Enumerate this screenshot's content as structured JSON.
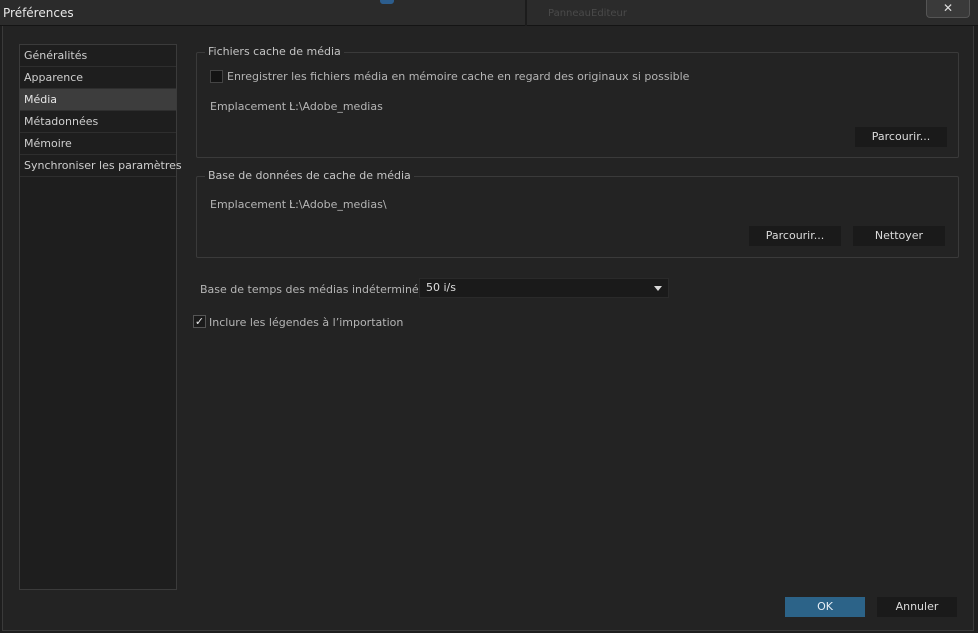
{
  "window": {
    "title": "Préférences",
    "close_glyph": "✕",
    "background_app_label": "PanneauEditeur"
  },
  "sidebar": {
    "items": [
      {
        "label": "Généralités",
        "active": false
      },
      {
        "label": "Apparence",
        "active": false
      },
      {
        "label": "Média",
        "active": true
      },
      {
        "label": "Métadonnées",
        "active": false
      },
      {
        "label": "Mémoire",
        "active": false
      },
      {
        "label": "Synchroniser les paramètres",
        "active": false
      }
    ]
  },
  "media_cache_files": {
    "legend": "Fichiers cache de média",
    "checkbox_label": "Enregistrer les fichiers média en mémoire cache en regard des originaux si possible",
    "checkbox_checked": false,
    "location_label": "Emplacement :",
    "location_value": "L:\\Adobe_medias",
    "browse_label": "Parcourir..."
  },
  "media_cache_db": {
    "legend": "Base de données de cache de média",
    "location_label": "Emplacement :",
    "location_value": "L:\\Adobe_medias\\",
    "browse_label": "Parcourir...",
    "clean_label": "Nettoyer"
  },
  "timebase": {
    "label": "Base de temps des médias indéterminée :",
    "value": "50 i/s"
  },
  "include_captions": {
    "label": "Inclure les légendes à l’importation",
    "checked": true,
    "check_glyph": "✓"
  },
  "footer": {
    "ok_label": "OK",
    "cancel_label": "Annuler"
  },
  "colors": {
    "accent": "#2c6388",
    "panel_bg": "#232323",
    "sidebar_active": "#3d3d3d"
  }
}
